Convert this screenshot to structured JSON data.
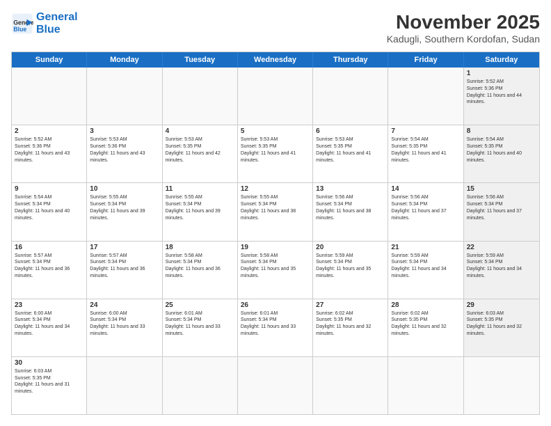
{
  "header": {
    "logo_general": "General",
    "logo_blue": "Blue",
    "month_title": "November 2025",
    "location": "Kadugli, Southern Kordofan, Sudan"
  },
  "days_of_week": [
    "Sunday",
    "Monday",
    "Tuesday",
    "Wednesday",
    "Thursday",
    "Friday",
    "Saturday"
  ],
  "weeks": [
    [
      {
        "day": "",
        "text": "",
        "empty": true
      },
      {
        "day": "",
        "text": "",
        "empty": true
      },
      {
        "day": "",
        "text": "",
        "empty": true
      },
      {
        "day": "",
        "text": "",
        "empty": true
      },
      {
        "day": "",
        "text": "",
        "empty": true
      },
      {
        "day": "",
        "text": "",
        "empty": true
      },
      {
        "day": "1",
        "text": "Sunrise: 5:52 AM\nSunset: 5:36 PM\nDaylight: 11 hours and 44 minutes.",
        "shaded": true
      }
    ],
    [
      {
        "day": "2",
        "text": "Sunrise: 5:52 AM\nSunset: 5:36 PM\nDaylight: 11 hours and 43 minutes.",
        "shaded": false
      },
      {
        "day": "3",
        "text": "Sunrise: 5:53 AM\nSunset: 5:36 PM\nDaylight: 11 hours and 43 minutes.",
        "shaded": false
      },
      {
        "day": "4",
        "text": "Sunrise: 5:53 AM\nSunset: 5:35 PM\nDaylight: 11 hours and 42 minutes.",
        "shaded": false
      },
      {
        "day": "5",
        "text": "Sunrise: 5:53 AM\nSunset: 5:35 PM\nDaylight: 11 hours and 41 minutes.",
        "shaded": false
      },
      {
        "day": "6",
        "text": "Sunrise: 5:53 AM\nSunset: 5:35 PM\nDaylight: 11 hours and 41 minutes.",
        "shaded": false
      },
      {
        "day": "7",
        "text": "Sunrise: 5:54 AM\nSunset: 5:35 PM\nDaylight: 11 hours and 41 minutes.",
        "shaded": false
      },
      {
        "day": "8",
        "text": "Sunrise: 5:54 AM\nSunset: 5:35 PM\nDaylight: 11 hours and 40 minutes.",
        "shaded": true
      }
    ],
    [
      {
        "day": "9",
        "text": "Sunrise: 5:54 AM\nSunset: 5:34 PM\nDaylight: 11 hours and 40 minutes.",
        "shaded": false
      },
      {
        "day": "10",
        "text": "Sunrise: 5:55 AM\nSunset: 5:34 PM\nDaylight: 11 hours and 39 minutes.",
        "shaded": false
      },
      {
        "day": "11",
        "text": "Sunrise: 5:55 AM\nSunset: 5:34 PM\nDaylight: 11 hours and 39 minutes.",
        "shaded": false
      },
      {
        "day": "12",
        "text": "Sunrise: 5:55 AM\nSunset: 5:34 PM\nDaylight: 11 hours and 38 minutes.",
        "shaded": false
      },
      {
        "day": "13",
        "text": "Sunrise: 5:56 AM\nSunset: 5:34 PM\nDaylight: 11 hours and 38 minutes.",
        "shaded": false
      },
      {
        "day": "14",
        "text": "Sunrise: 5:56 AM\nSunset: 5:34 PM\nDaylight: 11 hours and 37 minutes.",
        "shaded": false
      },
      {
        "day": "15",
        "text": "Sunrise: 5:56 AM\nSunset: 5:34 PM\nDaylight: 11 hours and 37 minutes.",
        "shaded": true
      }
    ],
    [
      {
        "day": "16",
        "text": "Sunrise: 5:57 AM\nSunset: 5:34 PM\nDaylight: 11 hours and 36 minutes.",
        "shaded": false
      },
      {
        "day": "17",
        "text": "Sunrise: 5:57 AM\nSunset: 5:34 PM\nDaylight: 11 hours and 36 minutes.",
        "shaded": false
      },
      {
        "day": "18",
        "text": "Sunrise: 5:58 AM\nSunset: 5:34 PM\nDaylight: 11 hours and 36 minutes.",
        "shaded": false
      },
      {
        "day": "19",
        "text": "Sunrise: 5:58 AM\nSunset: 5:34 PM\nDaylight: 11 hours and 35 minutes.",
        "shaded": false
      },
      {
        "day": "20",
        "text": "Sunrise: 5:59 AM\nSunset: 5:34 PM\nDaylight: 11 hours and 35 minutes.",
        "shaded": false
      },
      {
        "day": "21",
        "text": "Sunrise: 5:59 AM\nSunset: 5:34 PM\nDaylight: 11 hours and 34 minutes.",
        "shaded": false
      },
      {
        "day": "22",
        "text": "Sunrise: 5:59 AM\nSunset: 5:34 PM\nDaylight: 11 hours and 34 minutes.",
        "shaded": true
      }
    ],
    [
      {
        "day": "23",
        "text": "Sunrise: 6:00 AM\nSunset: 5:34 PM\nDaylight: 11 hours and 34 minutes.",
        "shaded": false
      },
      {
        "day": "24",
        "text": "Sunrise: 6:00 AM\nSunset: 5:34 PM\nDaylight: 11 hours and 33 minutes.",
        "shaded": false
      },
      {
        "day": "25",
        "text": "Sunrise: 6:01 AM\nSunset: 5:34 PM\nDaylight: 11 hours and 33 minutes.",
        "shaded": false
      },
      {
        "day": "26",
        "text": "Sunrise: 6:01 AM\nSunset: 5:34 PM\nDaylight: 11 hours and 33 minutes.",
        "shaded": false
      },
      {
        "day": "27",
        "text": "Sunrise: 6:02 AM\nSunset: 5:35 PM\nDaylight: 11 hours and 32 minutes.",
        "shaded": false
      },
      {
        "day": "28",
        "text": "Sunrise: 6:02 AM\nSunset: 5:35 PM\nDaylight: 11 hours and 32 minutes.",
        "shaded": false
      },
      {
        "day": "29",
        "text": "Sunrise: 6:03 AM\nSunset: 5:35 PM\nDaylight: 11 hours and 32 minutes.",
        "shaded": true
      }
    ],
    [
      {
        "day": "30",
        "text": "Sunrise: 6:03 AM\nSunset: 5:35 PM\nDaylight: 11 hours and 31 minutes.",
        "shaded": false
      },
      {
        "day": "",
        "text": "",
        "empty": true
      },
      {
        "day": "",
        "text": "",
        "empty": true
      },
      {
        "day": "",
        "text": "",
        "empty": true
      },
      {
        "day": "",
        "text": "",
        "empty": true
      },
      {
        "day": "",
        "text": "",
        "empty": true
      },
      {
        "day": "",
        "text": "",
        "empty": true
      }
    ]
  ]
}
